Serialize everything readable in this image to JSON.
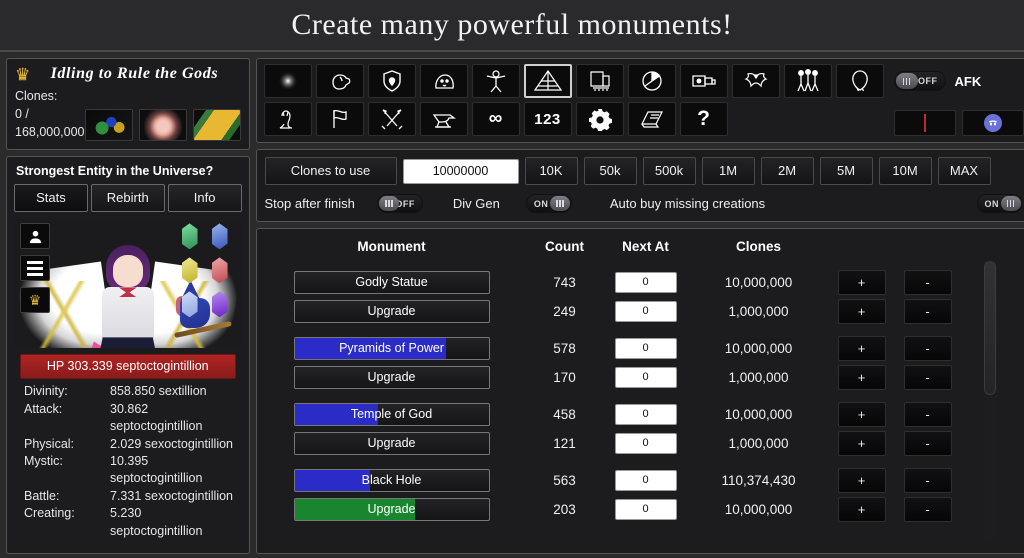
{
  "banner": {
    "title": "Create many powerful monuments!"
  },
  "game": {
    "title": "Idling to Rule the Gods",
    "crown_icon": "crown-icon",
    "clones_label": "Clones:",
    "clones_value": "0 / 168,000,000",
    "item_icons": [
      "candy-item-icon",
      "rose-item-icon",
      "gold-item-icon"
    ]
  },
  "entity": {
    "title": "Strongest Entity in the Universe?",
    "tabs": [
      {
        "label": "Stats",
        "active": true
      },
      {
        "label": "Rebirth",
        "active": false
      },
      {
        "label": "Info",
        "active": false
      }
    ],
    "side_buttons": [
      "profile-icon",
      "menu-icon",
      "crown-icon"
    ],
    "gems": [
      {
        "name": "green-gem",
        "color": "#3faf6a"
      },
      {
        "name": "blue-gem",
        "color": "#5878d8"
      },
      {
        "name": "yellow-gem",
        "color": "#d8cc50"
      },
      {
        "name": "red-gem",
        "color": "#d06a70"
      },
      {
        "name": "light-blue-gem",
        "color": "#aab8e8"
      },
      {
        "name": "purple-gem",
        "color": "#8a46d8"
      }
    ],
    "hp": "HP 303.339 septoctogintillion",
    "hp_color": "#b02424",
    "stats": [
      {
        "key": "Divinity:",
        "value": "858.850 sextillion"
      },
      {
        "key": "Attack:",
        "value": "30.862 septoctogintillion"
      },
      {
        "key": "Physical:",
        "value": "2.029 sexoctogintillion"
      },
      {
        "key": "Mystic:",
        "value": "10.395 septoctogintillion"
      },
      {
        "key": "Battle:",
        "value": "7.331 sexoctogintillion"
      },
      {
        "key": "Creating:",
        "value": "5.230 septoctogintillion"
      }
    ]
  },
  "toolbar": {
    "row1": [
      {
        "name": "glow-orb-icon",
        "selected": false
      },
      {
        "name": "fist-icon",
        "selected": false
      },
      {
        "name": "shield-icon",
        "selected": false
      },
      {
        "name": "slime-icon",
        "selected": false
      },
      {
        "name": "training-body-icon",
        "selected": false
      },
      {
        "name": "pyramid-icon",
        "selected": true
      },
      {
        "name": "building-icon",
        "selected": false
      },
      {
        "name": "pie-chart-icon",
        "selected": false
      },
      {
        "name": "flashlight-icon",
        "selected": false
      },
      {
        "name": "bat-icon",
        "selected": false
      },
      {
        "name": "three-people-icon",
        "selected": false
      },
      {
        "name": "ghost-icon",
        "selected": false
      }
    ],
    "row2": [
      {
        "name": "cat-icon",
        "selected": false
      },
      {
        "name": "flag-icon",
        "selected": false
      },
      {
        "name": "crossed-swords-icon",
        "selected": false
      },
      {
        "name": "anvil-icon",
        "selected": false
      },
      {
        "name": "infinity-icon",
        "selected": false,
        "text": "∞"
      },
      {
        "name": "numbers-icon",
        "selected": false,
        "text": "123"
      },
      {
        "name": "gear-icon",
        "selected": false
      },
      {
        "name": "book-icon",
        "selected": false
      },
      {
        "name": "help-icon",
        "selected": false,
        "text": "?"
      }
    ],
    "afk": {
      "label": "AFK",
      "state": "OFF",
      "on": false
    },
    "mini_buttons": [
      {
        "name": "red-marker-button"
      },
      {
        "name": "discord-button"
      }
    ]
  },
  "controls": {
    "clones_to_use_label": "Clones to use",
    "clones_to_use_value": "10000000",
    "amount_buttons": [
      "10K",
      "50k",
      "500k",
      "1M",
      "2M",
      "5M",
      "10M",
      "MAX"
    ],
    "stop_after_finish": {
      "label": "Stop after finish",
      "state": "OFF",
      "on": false
    },
    "div_gen": {
      "label": "Div Gen",
      "state": "ON",
      "on": true
    },
    "auto_buy": {
      "label": "Auto buy missing creations",
      "state": "ON",
      "on": true
    }
  },
  "table": {
    "headers": {
      "monument": "Monument",
      "count": "Count",
      "next_at": "Next At",
      "clones": "Clones"
    },
    "plus_label": "+",
    "minus_label": "-",
    "rows": [
      {
        "name": "Godly Statue",
        "count": "743",
        "next_at": "0",
        "clones": "10,000,000",
        "fill": 0,
        "fill_color": "none",
        "group_start": false
      },
      {
        "name": "Upgrade",
        "count": "249",
        "next_at": "0",
        "clones": "1,000,000",
        "fill": 0,
        "fill_color": "none",
        "group_start": false
      },
      {
        "name": "Pyramids of Power",
        "count": "578",
        "next_at": "0",
        "clones": "10,000,000",
        "fill": 78,
        "fill_color": "blue",
        "group_start": true
      },
      {
        "name": "Upgrade",
        "count": "170",
        "next_at": "0",
        "clones": "1,000,000",
        "fill": 0,
        "fill_color": "none",
        "group_start": false
      },
      {
        "name": "Temple of God",
        "count": "458",
        "next_at": "0",
        "clones": "10,000,000",
        "fill": 43,
        "fill_color": "blue",
        "group_start": true
      },
      {
        "name": "Upgrade",
        "count": "121",
        "next_at": "0",
        "clones": "1,000,000",
        "fill": 0,
        "fill_color": "none",
        "group_start": false
      },
      {
        "name": "Black Hole",
        "count": "563",
        "next_at": "0",
        "clones": "110,374,430",
        "fill": 39,
        "fill_color": "blue",
        "group_start": true
      },
      {
        "name": "Upgrade",
        "count": "203",
        "next_at": "0",
        "clones": "10,000,000",
        "fill": 62,
        "fill_color": "green",
        "group_start": false
      }
    ],
    "scroll_position_percent": 0
  }
}
